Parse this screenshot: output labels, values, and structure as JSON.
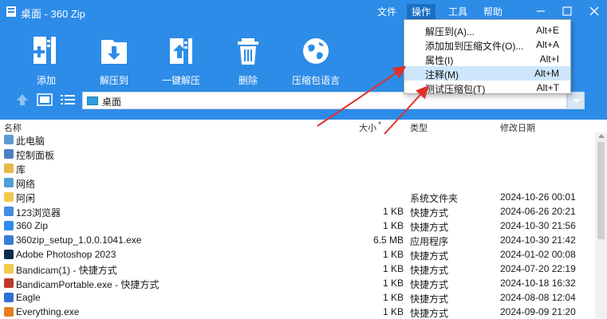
{
  "window": {
    "title": "桌面 - 360 Zip"
  },
  "menubar": {
    "file": "文件",
    "operate": "操作",
    "tools": "工具",
    "help": "帮助"
  },
  "toolbar": {
    "add": "添加",
    "extract_to": "解压到",
    "one_click_extract": "一键解压",
    "delete": "删除",
    "archive_language": "压缩包语言"
  },
  "address": {
    "path": "桌面"
  },
  "columns": {
    "name": "名称",
    "size": "大小",
    "type": "类型",
    "modified": "修改日期"
  },
  "files": [
    {
      "name": "此电脑",
      "size": "",
      "type": "",
      "date": "",
      "icon": "computer-icon",
      "color": "#5b9bd5"
    },
    {
      "name": "控制面板",
      "size": "",
      "type": "",
      "date": "",
      "icon": "control-panel-icon",
      "color": "#4a7fc1"
    },
    {
      "name": "库",
      "size": "",
      "type": "",
      "date": "",
      "icon": "library-icon",
      "color": "#e8b84a"
    },
    {
      "name": "网络",
      "size": "",
      "type": "",
      "date": "",
      "icon": "network-icon",
      "color": "#4f9fd8"
    },
    {
      "name": "阿闲",
      "size": "",
      "type": "系统文件夹",
      "date": "2024-10-26 00:01",
      "icon": "folder-icon",
      "color": "#f2c94c"
    },
    {
      "name": "123浏览器",
      "size": "1 KB",
      "type": "快捷方式",
      "date": "2024-06-26 20:21",
      "icon": "browser-icon",
      "color": "#3f8de0"
    },
    {
      "name": "360 Zip",
      "size": "1 KB",
      "type": "快捷方式",
      "date": "2024-10-30 21:56",
      "icon": "zip-icon",
      "color": "#2d8ce8"
    },
    {
      "name": "360zip_setup_1.0.0.1041.exe",
      "size": "6.5 MB",
      "type": "应用程序",
      "date": "2024-10-30 21:42",
      "icon": "installer-icon",
      "color": "#3a7bd5"
    },
    {
      "name": "Adobe Photoshop 2023",
      "size": "1 KB",
      "type": "快捷方式",
      "date": "2024-01-02 00:08",
      "icon": "photoshop-icon",
      "color": "#0b2a4a"
    },
    {
      "name": "Bandicam(1) - 快捷方式",
      "size": "1 KB",
      "type": "快捷方式",
      "date": "2024-07-20 22:19",
      "icon": "folder-icon",
      "color": "#f2c94c"
    },
    {
      "name": "BandicamPortable.exe - 快捷方式",
      "size": "1 KB",
      "type": "快捷方式",
      "date": "2024-10-18 16:32",
      "icon": "bandicam-icon",
      "color": "#c0392b"
    },
    {
      "name": "Eagle",
      "size": "1 KB",
      "type": "快捷方式",
      "date": "2024-08-08 12:04",
      "icon": "eagle-icon",
      "color": "#2f6fd1"
    },
    {
      "name": "Everything.exe",
      "size": "1 KB",
      "type": "快捷方式",
      "date": "2024-09-09 21:20",
      "icon": "search-icon",
      "color": "#e67e22"
    }
  ],
  "operate_menu": [
    {
      "label": "解压到(A)...",
      "shortcut": "Alt+E"
    },
    {
      "label": "添加加到压缩文件(O)...",
      "shortcut": "Alt+A"
    },
    {
      "label": "属性(I)",
      "shortcut": "Alt+I"
    },
    {
      "label": "注释(M)",
      "shortcut": "Alt+M"
    },
    {
      "label": "测试压缩包(T)",
      "shortcut": "Alt+T"
    }
  ],
  "colors": {
    "accent": "#2d8ce8",
    "menu_active": "#1a6fc4",
    "menu_highlight": "#cde6fb",
    "arrow": "#e0312c"
  }
}
